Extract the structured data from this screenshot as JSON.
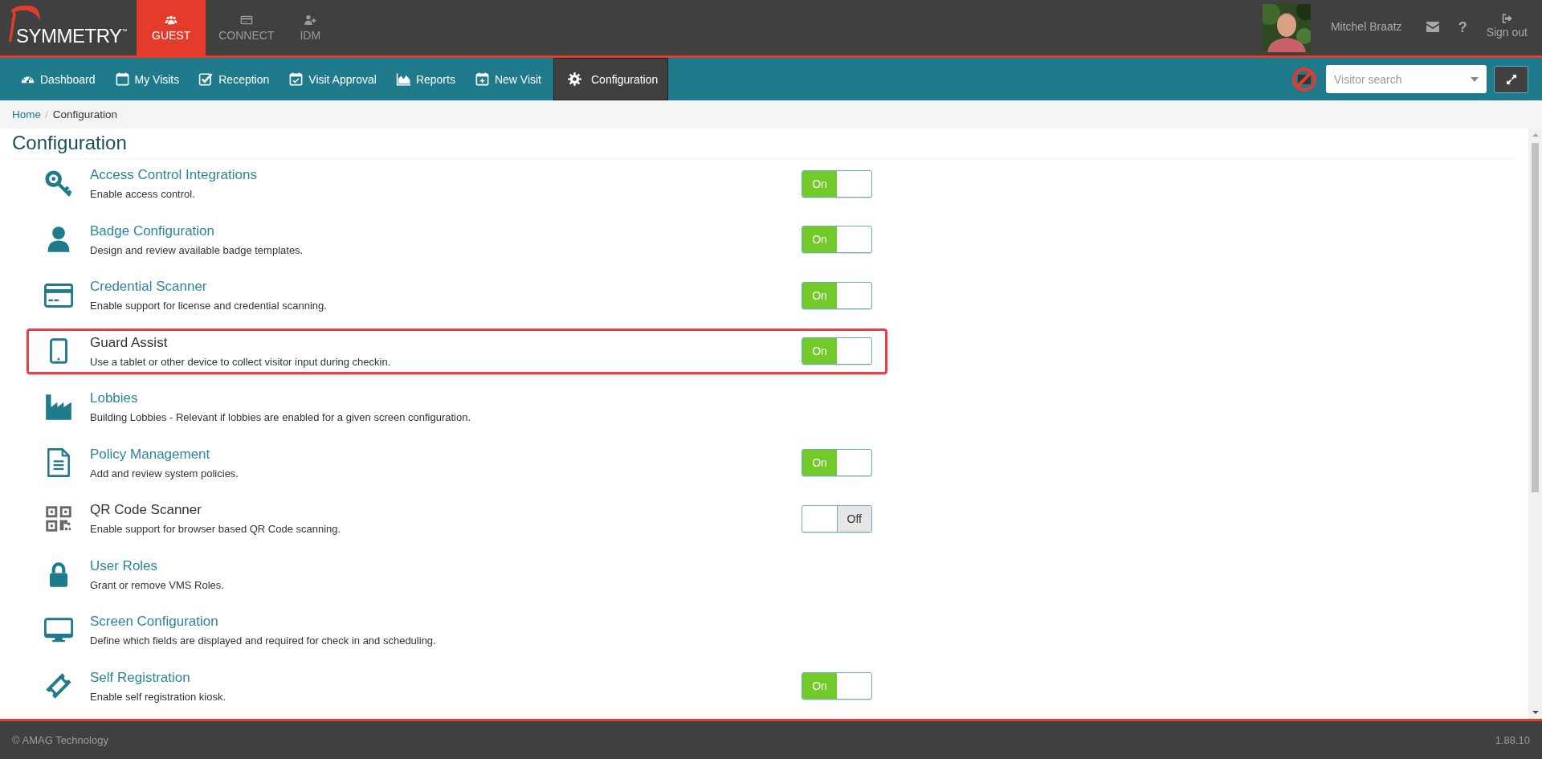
{
  "brand": {
    "name": "SYMMETRY",
    "mark": "™"
  },
  "apps": [
    {
      "label": "GUEST",
      "selected": true
    },
    {
      "label": "CONNECT",
      "selected": false
    },
    {
      "label": "IDM",
      "selected": false
    }
  ],
  "user": {
    "name": "Mitchel Braatz",
    "help": "?",
    "sign_out": "Sign out"
  },
  "nav": [
    {
      "label": "Dashboard",
      "selected": false
    },
    {
      "label": "My Visits",
      "selected": false
    },
    {
      "label": "Reception",
      "selected": false
    },
    {
      "label": "Visit Approval",
      "selected": false
    },
    {
      "label": "Reports",
      "selected": false
    },
    {
      "label": "New Visit",
      "selected": false
    },
    {
      "label": "Configuration",
      "selected": true
    }
  ],
  "search": {
    "placeholder": "Visitor search"
  },
  "breadcrumb": {
    "separator": "/",
    "items": [
      {
        "label": "Home",
        "link": true
      },
      {
        "label": "Configuration",
        "link": false
      }
    ]
  },
  "page_title": "Configuration",
  "items": [
    {
      "title": "Access Control Integrations",
      "description": "Enable access control.",
      "link": true,
      "highlighted": false,
      "toggle": {
        "on": true,
        "label": "On"
      }
    },
    {
      "title": "Badge Configuration",
      "description": "Design and review available badge templates.",
      "link": true,
      "highlighted": false,
      "toggle": {
        "on": true,
        "label": "On"
      }
    },
    {
      "title": "Credential Scanner",
      "description": "Enable support for license and credential scanning.",
      "link": true,
      "highlighted": false,
      "toggle": {
        "on": true,
        "label": "On"
      }
    },
    {
      "title": "Guard Assist",
      "description": "Use a tablet or other device to collect visitor input during checkin.",
      "link": false,
      "highlighted": true,
      "toggle": {
        "on": true,
        "label": "On"
      }
    },
    {
      "title": "Lobbies",
      "description": "Building Lobbies - Relevant if lobbies are enabled for a given screen configuration.",
      "link": true,
      "highlighted": false
    },
    {
      "title": "Policy Management",
      "description": "Add and review system policies.",
      "link": true,
      "highlighted": false,
      "toggle": {
        "on": true,
        "label": "On"
      }
    },
    {
      "title": "QR Code Scanner",
      "description": "Enable support for browser based QR Code scanning.",
      "link": false,
      "highlighted": false,
      "toggle": {
        "on": false,
        "label": "Off"
      }
    },
    {
      "title": "User Roles",
      "description": "Grant or remove VMS Roles.",
      "link": true,
      "highlighted": false
    },
    {
      "title": "Screen Configuration",
      "description": "Define which fields are displayed and required for check in and scheduling.",
      "link": true,
      "highlighted": false
    },
    {
      "title": "Self Registration",
      "description": "Enable self registration kiosk.",
      "link": true,
      "highlighted": false,
      "toggle": {
        "on": true,
        "label": "On"
      }
    }
  ],
  "footer": {
    "copyright": "© AMAG Technology",
    "version": "1.88.10"
  }
}
